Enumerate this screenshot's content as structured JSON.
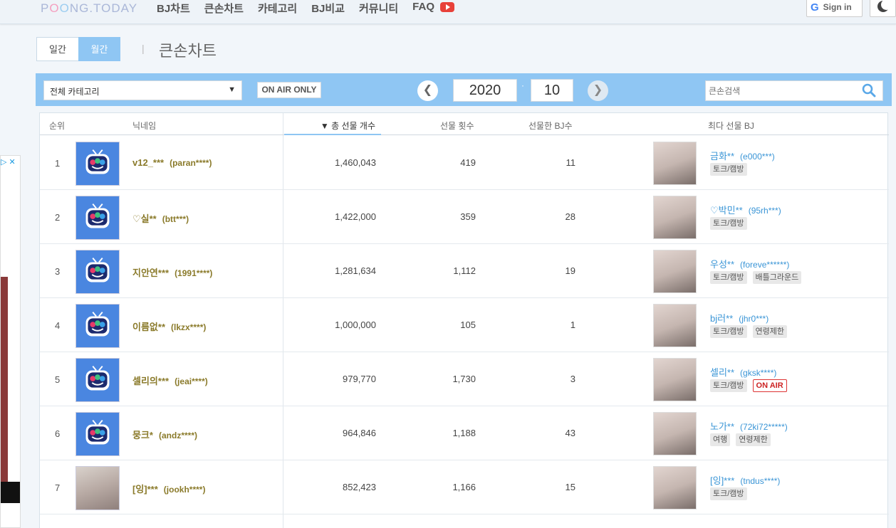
{
  "logo": {
    "text_a": "P",
    "text_o1": "O",
    "text_o2": "O",
    "text_b": "NG.TODAY"
  },
  "nav": {
    "items": [
      "BJ차트",
      "큰손차트",
      "카테고리",
      "BJ비교",
      "커뮤니티",
      "FAQ"
    ]
  },
  "auth": {
    "signin_label": "Sign in"
  },
  "period": {
    "daily": "일간",
    "monthly": "월간"
  },
  "page_title": "큰손차트",
  "filters": {
    "category": "전체 카테고리",
    "onair": "ON AIR ONLY",
    "year": "2020",
    "month": "10",
    "date_sep": "·",
    "prev_arrow": "❮",
    "next_arrow": "❯",
    "search_placeholder": "큰손검색"
  },
  "table": {
    "headers": {
      "rank": "순위",
      "nickname": "닉네임",
      "total": "▼ 총 선물 개수",
      "count": "선물 횟수",
      "bjs": "선물한 BJ수",
      "top_bj": "최다 선물 BJ"
    },
    "rows": [
      {
        "rank": "1",
        "nick": "v12_***",
        "uid": "(paran****)",
        "total": "1,460,043",
        "count": "419",
        "bjs": "11",
        "bj_name": "금화**",
        "bj_uid": "(e000***)",
        "tags": [
          "토크/캠방"
        ],
        "onair": "",
        "avatar": "tv"
      },
      {
        "rank": "2",
        "nick": "♡실**",
        "uid": "(btt***)",
        "total": "1,422,000",
        "count": "359",
        "bjs": "28",
        "bj_name": "♡박민**",
        "bj_uid": "(95rh***)",
        "tags": [
          "토크/캠방"
        ],
        "onair": "",
        "avatar": "tv"
      },
      {
        "rank": "3",
        "nick": "지안연***",
        "uid": "(1991****)",
        "total": "1,281,634",
        "count": "1,112",
        "bjs": "19",
        "bj_name": "우성**",
        "bj_uid": "(foreve******)",
        "tags": [
          "토크/캠방",
          "배틀그라운드"
        ],
        "onair": "",
        "avatar": "tv"
      },
      {
        "rank": "4",
        "nick": "이름없**",
        "uid": "(lkzx****)",
        "total": "1,000,000",
        "count": "105",
        "bjs": "1",
        "bj_name": "bj러**",
        "bj_uid": "(jhr0***)",
        "tags": [
          "토크/캠방",
          "연령제한"
        ],
        "onair": "",
        "avatar": "tv"
      },
      {
        "rank": "5",
        "nick": "셀리의***",
        "uid": "(jeai****)",
        "total": "979,770",
        "count": "1,730",
        "bjs": "3",
        "bj_name": "셀리**",
        "bj_uid": "(gksk****)",
        "tags": [
          "토크/캠방"
        ],
        "onair": "ON AIR",
        "avatar": "tv"
      },
      {
        "rank": "6",
        "nick": "뭉크*",
        "uid": "(andz****)",
        "total": "964,846",
        "count": "1,188",
        "bjs": "43",
        "bj_name": "노가**",
        "bj_uid": "(72ki72*****)",
        "tags": [
          "여행",
          "연령제한"
        ],
        "onair": "",
        "avatar": "tv"
      },
      {
        "rank": "7",
        "nick": "[잉]***",
        "uid": "(jookh****)",
        "total": "852,423",
        "count": "1,166",
        "bjs": "15",
        "bj_name": "[잉]***",
        "bj_uid": "(tndus****)",
        "tags": [
          "토크/캠방"
        ],
        "onair": "",
        "avatar": "photo"
      }
    ]
  }
}
